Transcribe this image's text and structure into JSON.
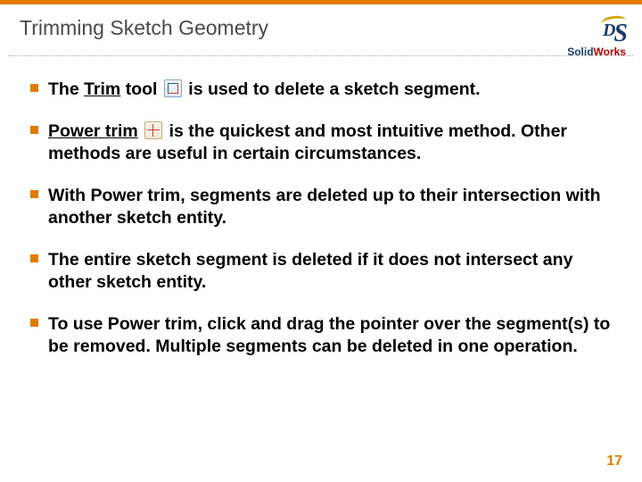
{
  "title": "Trimming Sketch Geometry",
  "logo": {
    "solid": "Solid",
    "works": "Works"
  },
  "bullets": {
    "b1": {
      "pre": "The ",
      "u": "Trim",
      "mid": " tool ",
      "post": " is used to delete a sketch segment."
    },
    "b2": {
      "u": "Power trim",
      "mid": " ",
      "post": " is the quickest and most intuitive method. Other methods are useful in certain circumstances."
    },
    "b3": "With Power trim, segments are deleted up to their intersection with another sketch entity.",
    "b4": "The entire sketch segment is deleted if it does not intersect any other sketch entity.",
    "b5": "To use Power trim, click and drag the pointer over the segment(s) to be removed. Multiple segments can be deleted in one operation."
  },
  "page": "17"
}
